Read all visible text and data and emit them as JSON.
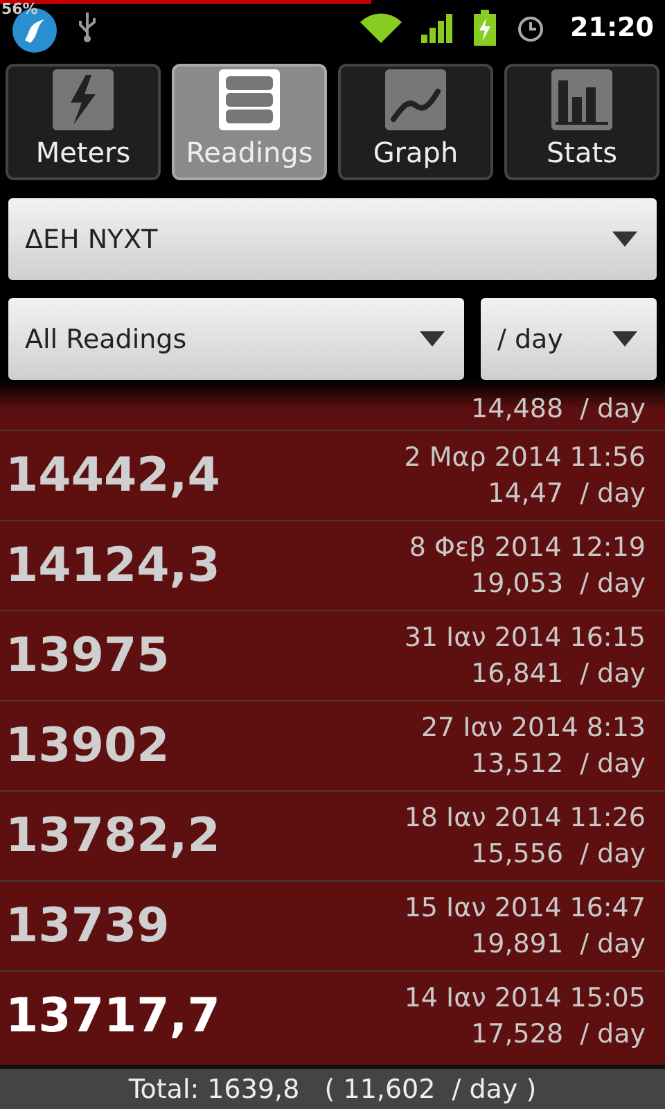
{
  "status_bar": {
    "battery_text": "56%",
    "time": "21:20"
  },
  "tabs": [
    {
      "label": "Meters",
      "selected": false
    },
    {
      "label": "Readings",
      "selected": true
    },
    {
      "label": "Graph",
      "selected": false
    },
    {
      "label": "Stats",
      "selected": false
    }
  ],
  "meter_select": {
    "value": "ΔΕΗ ΝΥΧΤ"
  },
  "filter_select": {
    "value": "All Readings"
  },
  "unit_select": {
    "value": "/ day"
  },
  "partial_row": {
    "rate": "14,488  / day"
  },
  "readings": [
    {
      "value": "14442,4",
      "date": "2 Μαρ 2014 11:56",
      "rate": "14,47  / day",
      "selected": false
    },
    {
      "value": "14124,3",
      "date": "8 Φεβ 2014 12:19",
      "rate": "19,053  / day",
      "selected": false
    },
    {
      "value": "13975",
      "date": "31 Ιαν 2014 16:15",
      "rate": "16,841  / day",
      "selected": false
    },
    {
      "value": "13902",
      "date": "27 Ιαν 2014 8:13",
      "rate": "13,512  / day",
      "selected": false
    },
    {
      "value": "13782,2",
      "date": "18 Ιαν 2014 11:26",
      "rate": "15,556  / day",
      "selected": false
    },
    {
      "value": "13739",
      "date": "15 Ιαν 2014 16:47",
      "rate": "19,891  / day",
      "selected": false
    },
    {
      "value": "13717,7",
      "date": "14 Ιαν 2014 15:05",
      "rate": "17,528  / day",
      "selected": true
    }
  ],
  "total": "Total: 1639,8   ( 11,602  / day )"
}
